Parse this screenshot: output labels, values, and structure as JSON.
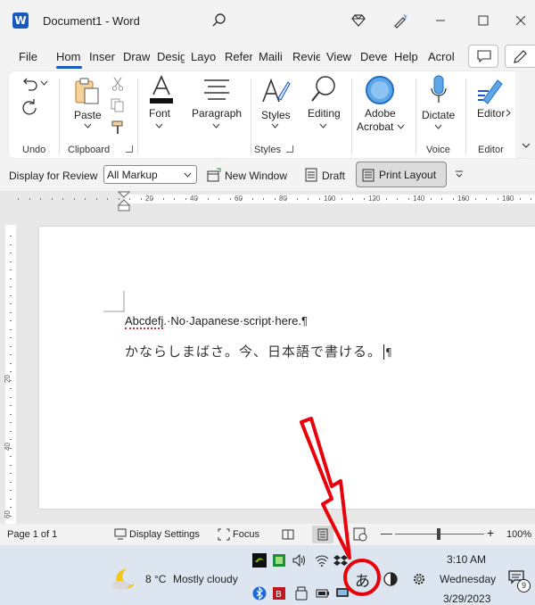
{
  "app": {
    "title": "Document1  -  Word",
    "logo_letter": "W"
  },
  "tabs": [
    "File",
    "Hom",
    "Inser",
    "Draw",
    "Desig",
    "Layo",
    "Refer",
    "Maili",
    "Revie",
    "View",
    "Deve",
    "Help",
    "Acrol"
  ],
  "active_tab": "Hom",
  "ribbon": {
    "undo_group": "Undo",
    "paste_label": "Paste",
    "clipboard_group": "Clipboard",
    "font_label": "Font",
    "paragraph_label": "Paragraph",
    "styles_label": "Styles",
    "styles_group": "Styles",
    "editing_label": "Editing",
    "adobe_label_1": "Adobe",
    "adobe_label_2": "Acrobat",
    "dictate_label": "Dictate",
    "voice_group": "Voice",
    "editor_label": "Editor",
    "editor_group": "Editor"
  },
  "review_bar": {
    "display_label": "Display for Review",
    "markup_value": "All Markup",
    "new_window": "New Window",
    "draft": "Draft",
    "print_layout": "Print Layout"
  },
  "ruler": {
    "h_ticks": [
      "20",
      "40",
      "60",
      "80",
      "100",
      "120",
      "140",
      "160",
      "180"
    ],
    "v_ticks": [
      "20",
      "40",
      "60"
    ]
  },
  "document": {
    "line1_a": "Abcdefj",
    "line1_b": ".·No·Japanese·script·here.¶",
    "line2": "かならしまばさ。今、日本語で書ける。",
    "line2_mark": "¶"
  },
  "status": {
    "page": "Page 1 of 1",
    "display_settings": "Display Settings",
    "focus": "Focus",
    "zoom": "100%",
    "zoom_minus": "—",
    "zoom_plus": "+"
  },
  "taskbar": {
    "weather_temp": "8 °C",
    "weather_desc": "Mostly cloudy",
    "ime_char": "あ",
    "time": "3:10 AM",
    "day": "Wednesday",
    "date": "3/29/2023",
    "notif_count": "9"
  },
  "colors": {
    "word_blue": "#185abd",
    "annotation_red": "#e8000b"
  }
}
